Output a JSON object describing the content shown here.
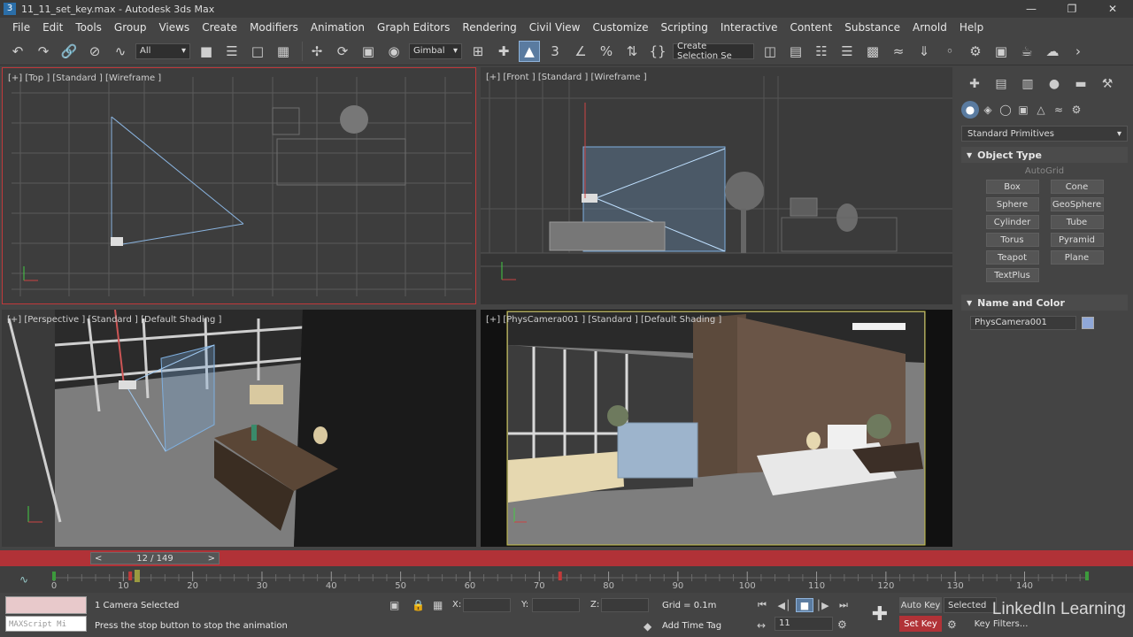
{
  "window": {
    "title": "11_11_set_key.max - Autodesk 3ds Max",
    "app_icon": "3",
    "controls": [
      "minimize-icon",
      "restore-icon",
      "close-icon"
    ]
  },
  "menu": [
    "File",
    "Edit",
    "Tools",
    "Group",
    "Views",
    "Create",
    "Modifiers",
    "Animation",
    "Graph Editors",
    "Rendering",
    "Civil View",
    "Customize",
    "Scripting",
    "Interactive",
    "Content",
    "Substance",
    "Arnold",
    "Help"
  ],
  "toolbar": {
    "filter_value": "All",
    "coord_system": "Gimbal",
    "snap_value": "3",
    "selection_set_placeholder": "Create Selection Se"
  },
  "viewports": {
    "top": "[+] [Top ] [Standard ] [Wireframe ]",
    "front": "[+] [Front ] [Standard ] [Wireframe ]",
    "perspective": "[+] [Perspective ] [Standard ] [Default Shading ]",
    "camera": "[+] [PhysCamera001 ] [Standard ] [Default Shading ]"
  },
  "command_panel": {
    "category": "Standard Primitives",
    "object_type_title": "Object Type",
    "autogrid": "AutoGrid",
    "primitives": [
      "Box",
      "Cone",
      "Sphere",
      "GeoSphere",
      "Cylinder",
      "Tube",
      "Torus",
      "Pyramid",
      "Teapot",
      "Plane",
      "TextPlus"
    ],
    "name_color_title": "Name and Color",
    "object_name": "PhysCamera001",
    "object_color": "#90a8d8"
  },
  "timeline": {
    "frame_display": "12 / 149",
    "current_frame": 12,
    "total_frames": 149,
    "key_frames": [
      0,
      11,
      73,
      149
    ],
    "tick_labels": [
      "0",
      "10",
      "20",
      "30",
      "40",
      "50",
      "60",
      "70",
      "80",
      "90",
      "100",
      "110",
      "120",
      "130",
      "140"
    ],
    "accent_color": "#b13237"
  },
  "status": {
    "selection_info": "1 Camera Selected",
    "prompt": "Press the stop button to stop the animation",
    "maxscript_placeholder": "MAXScript Mi",
    "x_label": "X:",
    "y_label": "Y:",
    "z_label": "Z:",
    "grid": "Grid = 0.1m",
    "add_time_tag": "Add Time Tag",
    "auto_key": "Auto Key",
    "set_key": "Set Key",
    "key_mode": "Selected",
    "key_filters": "Key Filters...",
    "frame_field": "11"
  },
  "branding": {
    "watermark": "LinkedIn Learning"
  }
}
